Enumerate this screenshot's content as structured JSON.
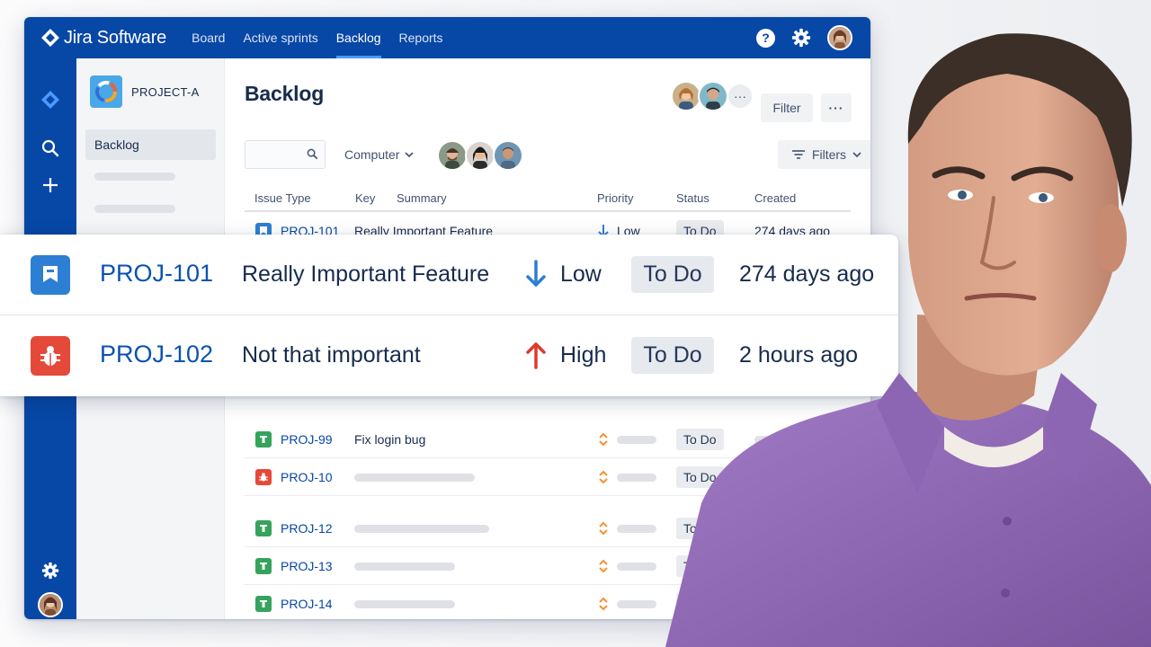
{
  "brand": {
    "name": "Jira Software"
  },
  "nav": {
    "items": [
      {
        "label": "Board",
        "active": false
      },
      {
        "label": "Active sprints",
        "active": false
      },
      {
        "label": "Backlog",
        "active": true
      },
      {
        "label": "Reports",
        "active": false
      }
    ],
    "help_glyph": "?"
  },
  "colors": {
    "nav_blue": "#0747a6",
    "story_blue": "#2d7fd3",
    "bug_red": "#e5493a",
    "task_green": "#36a35c",
    "priority_low": "#2d7fd3",
    "priority_high": "#de3a2b",
    "priority_medium": "#f79232"
  },
  "sidebar": {
    "project_name": "PROJECT-A",
    "active_item": "Backlog"
  },
  "main": {
    "title": "Backlog",
    "more_label": "···",
    "filter_button": "Filter",
    "filters_button": "Filters",
    "search": {
      "placeholder": "",
      "value": ""
    },
    "dropdown_label": "Computer",
    "columns": [
      "Issue Type",
      "Key",
      "Summary",
      "Priority",
      "Status",
      "Created"
    ]
  },
  "rows": [
    {
      "type": "story",
      "key": "PROJ-101",
      "summary": "Really Important Feature",
      "priority": "Low",
      "status": "To Do",
      "created": "274 days ago"
    },
    {
      "type": "task",
      "key": "PROJ-99",
      "summary": "Fix login bug",
      "priority": "medium",
      "status": "To Do",
      "created": ""
    },
    {
      "type": "bug",
      "key": "PROJ-10",
      "summary": "",
      "priority": "medium",
      "status": "To Do",
      "created": ""
    },
    {
      "type": "task",
      "key": "PROJ-12",
      "summary": "",
      "priority": "medium",
      "status": "To D",
      "created": ""
    },
    {
      "type": "task",
      "key": "PROJ-13",
      "summary": "",
      "priority": "medium",
      "status": "T",
      "created": ""
    },
    {
      "type": "task",
      "key": "PROJ-14",
      "summary": "",
      "priority": "medium",
      "status": "T",
      "created": ""
    }
  ],
  "zoom": [
    {
      "type": "story",
      "key": "PROJ-101",
      "summary": "Really Important Feature",
      "priority": "Low",
      "status": "To Do",
      "created": "274 days ago"
    },
    {
      "type": "bug",
      "key": "PROJ-102",
      "summary": "Not that important",
      "priority": "High",
      "status": "To Do",
      "created": "2 hours ago"
    }
  ],
  "icons": [
    "jira-logo-icon",
    "help-icon",
    "gear-icon",
    "search-icon",
    "plus-icon",
    "chevron-down-icon",
    "filter-lines-icon",
    "story-icon",
    "bug-icon",
    "task-icon",
    "arrow-down-icon",
    "arrow-up-icon",
    "medium-priority-icon"
  ]
}
